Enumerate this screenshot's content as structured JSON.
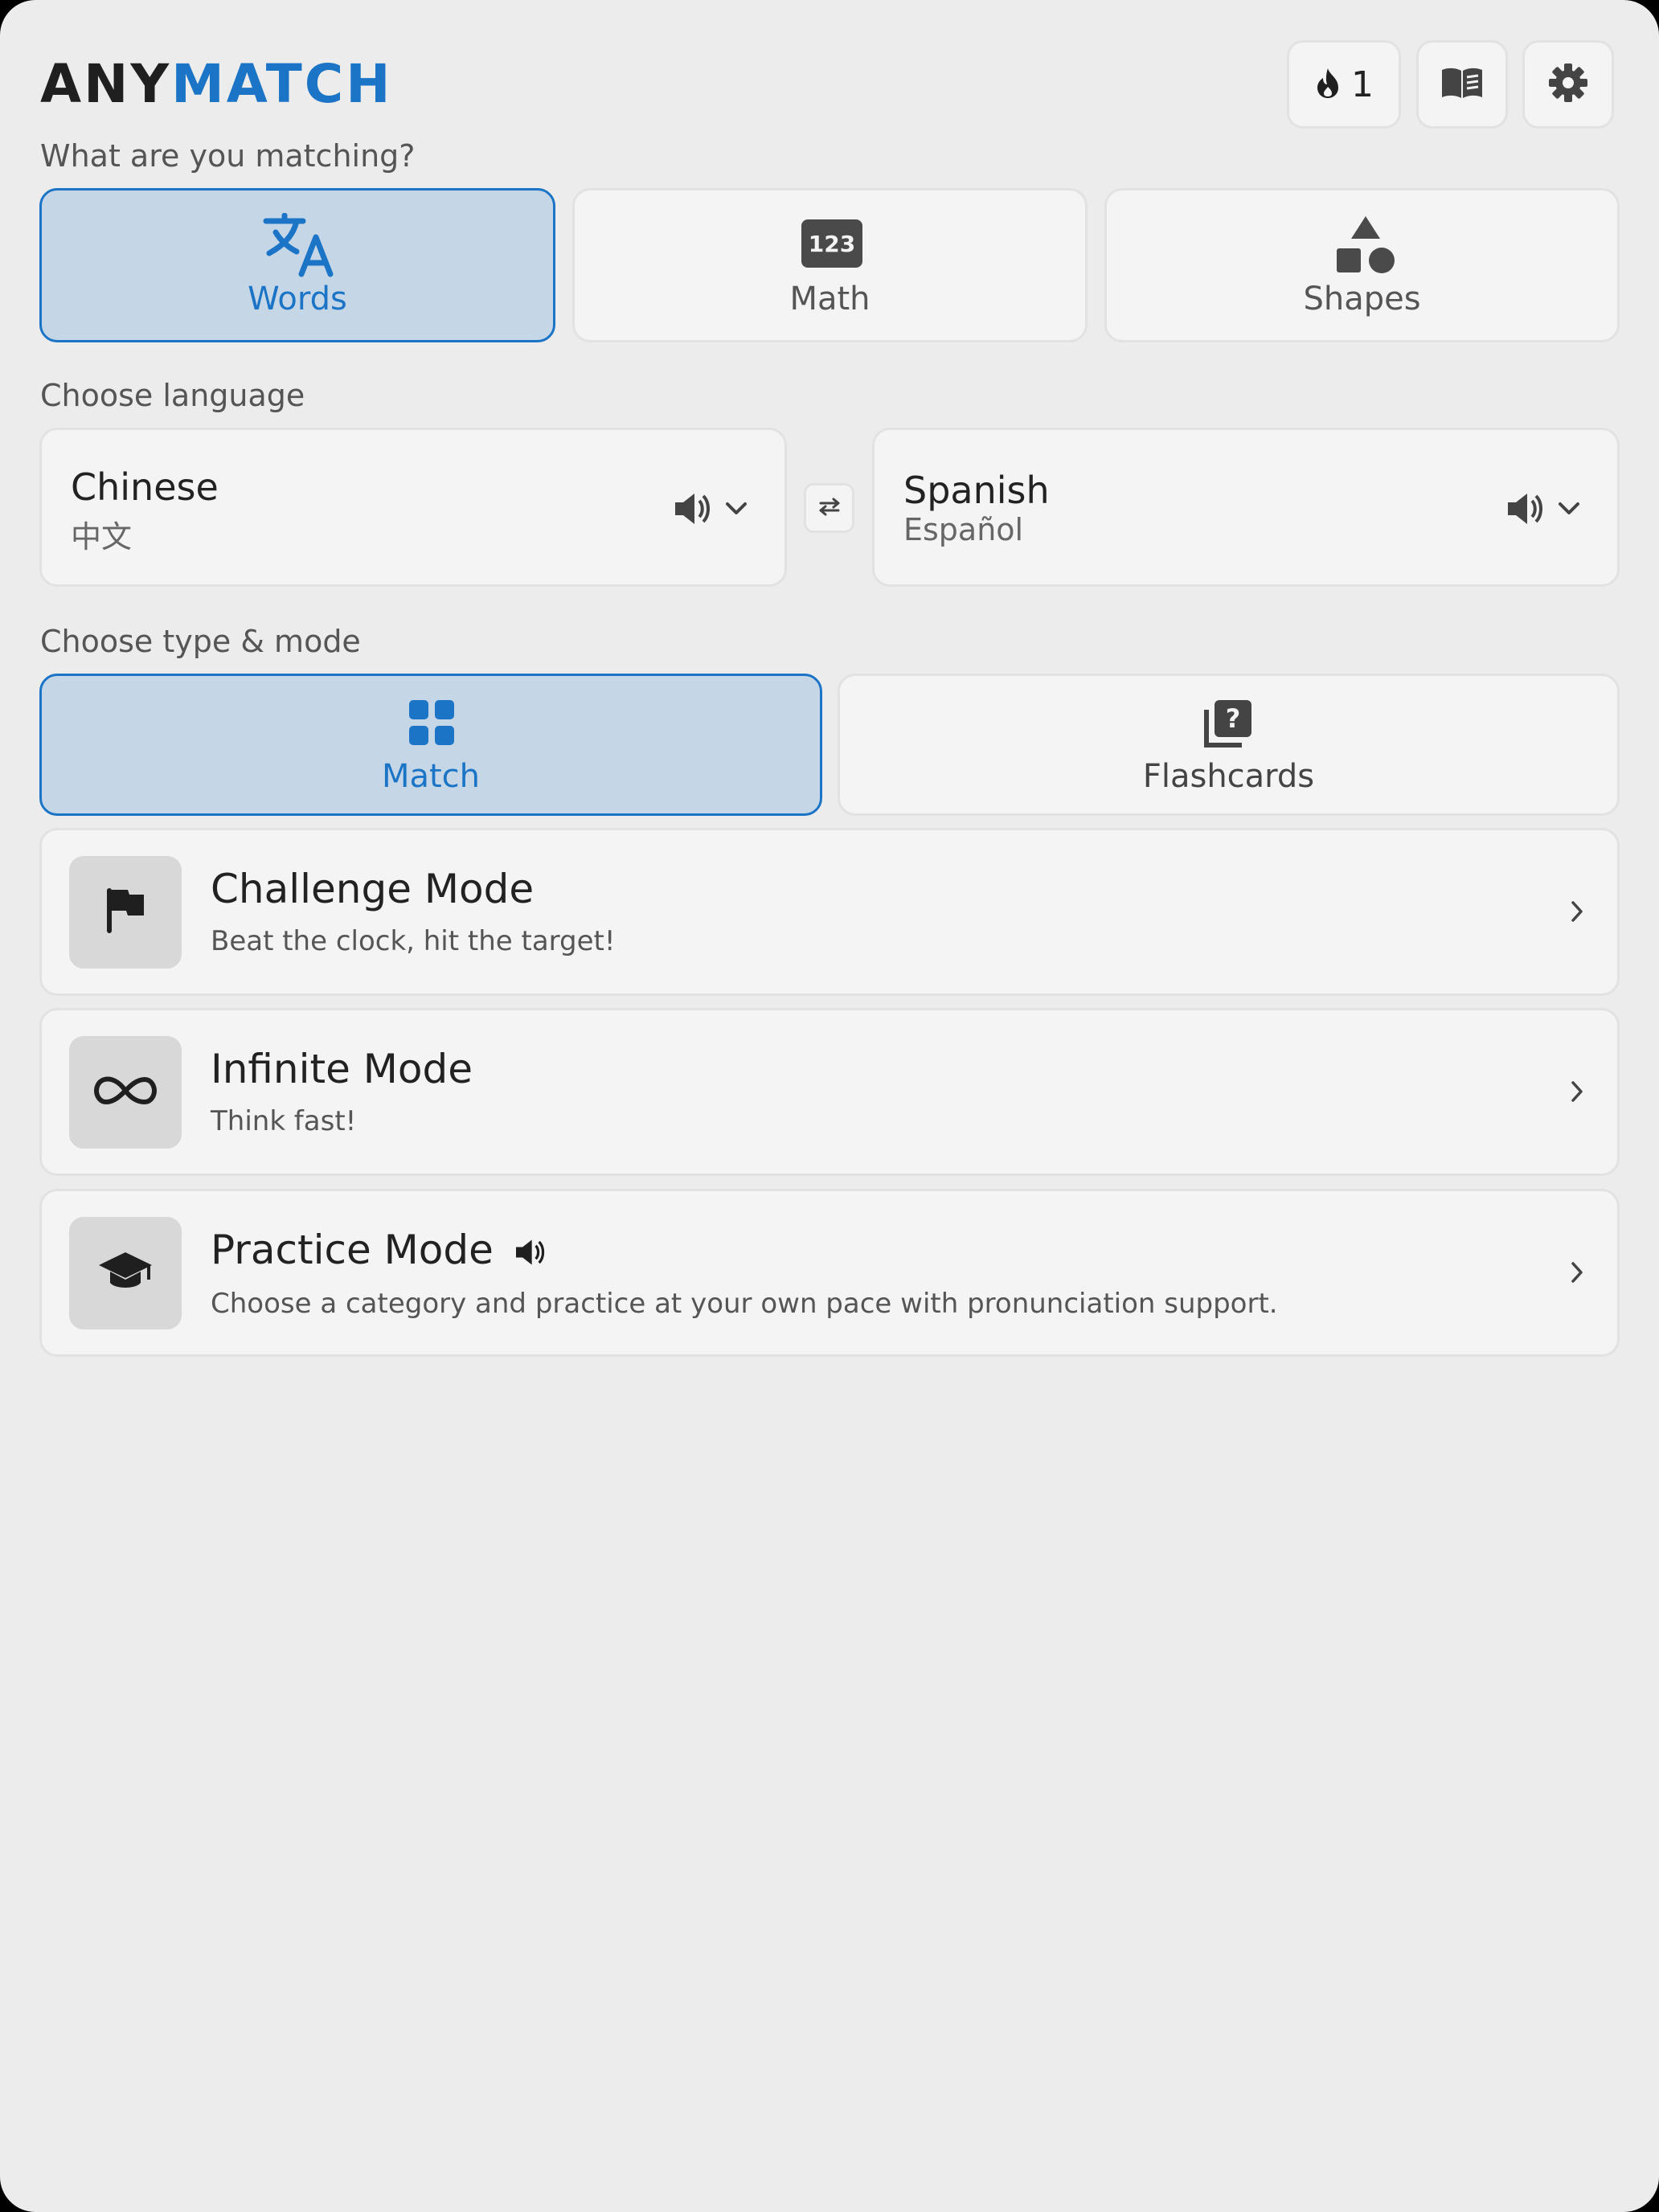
{
  "app": {
    "logo_part1": "ANY",
    "logo_part2": "MATCH",
    "accent": "#1b74c6"
  },
  "header": {
    "streak_count": "1",
    "streak_icon": "flame-icon",
    "book_icon": "book-icon",
    "settings_icon": "gear-icon"
  },
  "matching": {
    "label": "What are you matching?",
    "options": [
      {
        "label": "Words",
        "icon": "translate-icon",
        "selected": true
      },
      {
        "label": "Math",
        "icon": "numbers-123-icon",
        "selected": false
      },
      {
        "label": "Shapes",
        "icon": "shapes-icon",
        "selected": false
      }
    ]
  },
  "language": {
    "label": "Choose language",
    "source": {
      "name": "Chinese",
      "native": "中文"
    },
    "target": {
      "name": "Spanish",
      "native": "Español"
    }
  },
  "type_mode": {
    "label": "Choose type & mode",
    "options": [
      {
        "label": "Match",
        "icon": "grid-icon",
        "selected": true
      },
      {
        "label": "Flashcards",
        "icon": "flashcards-question-icon",
        "selected": false
      }
    ]
  },
  "modes": [
    {
      "title": "Challenge Mode",
      "desc": "Beat the clock, hit the target!",
      "icon": "flag-icon"
    },
    {
      "title": "Infinite Mode",
      "desc": "Think fast!",
      "icon": "infinity-icon"
    },
    {
      "title": "Practice Mode",
      "desc": "Choose a category and practice at your own pace with pronunciation support.",
      "icon": "graduation-cap-icon"
    }
  ]
}
